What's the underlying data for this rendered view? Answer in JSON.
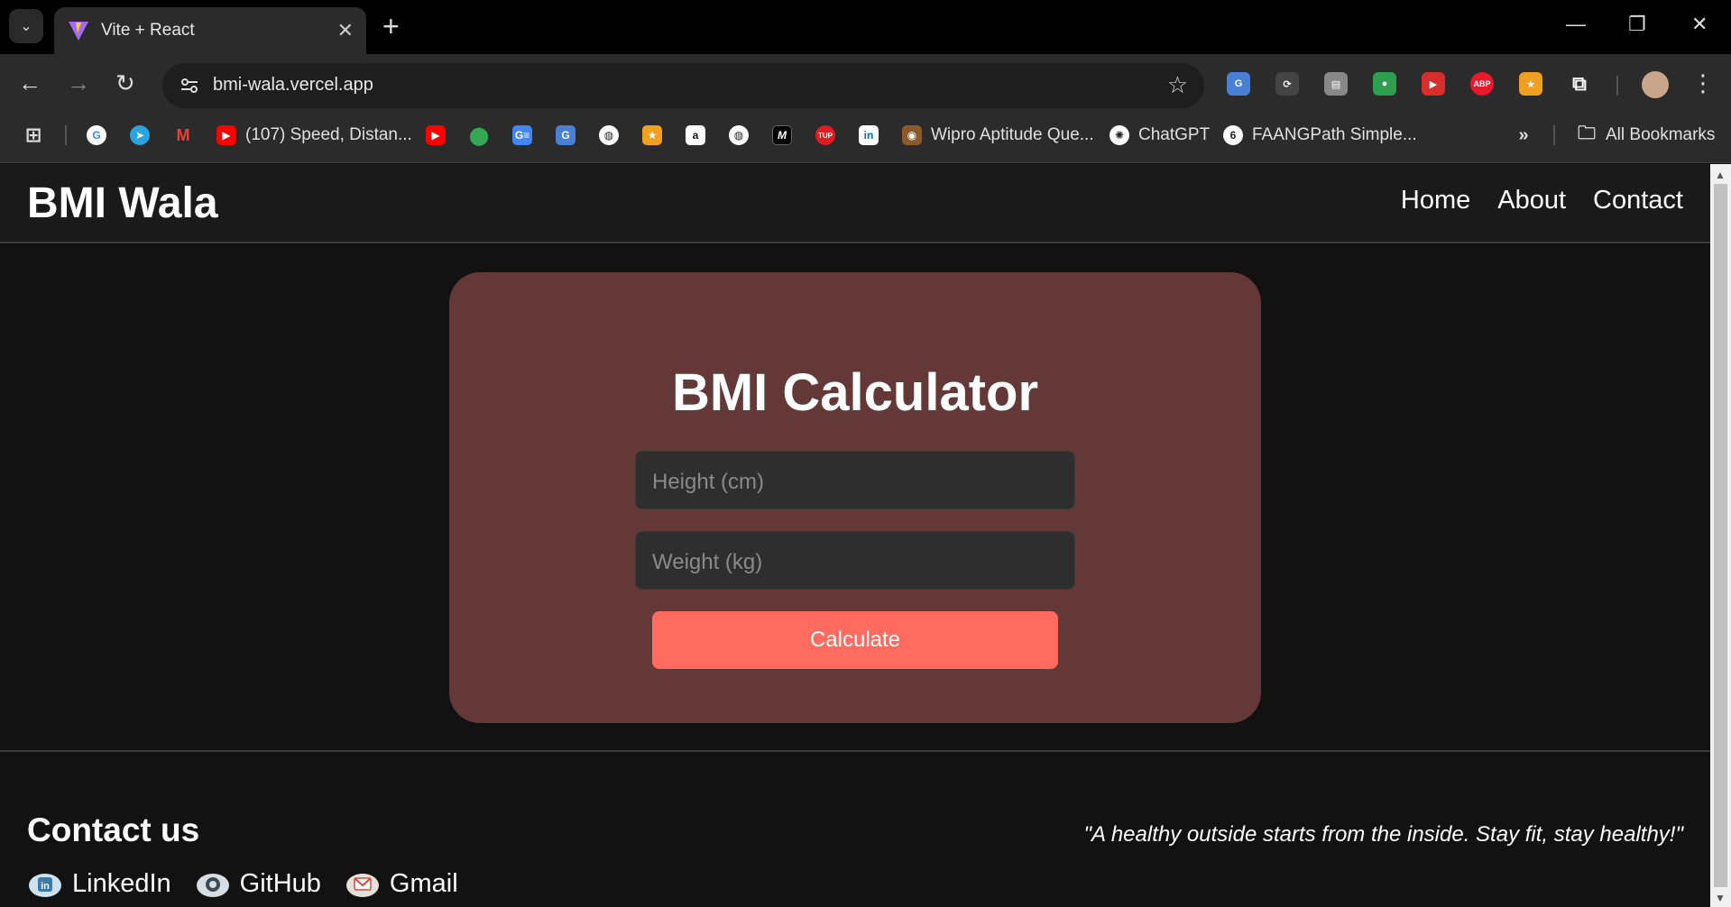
{
  "browser": {
    "tab_title": "Vite + React",
    "url": "bmi-wala.vercel.app",
    "bookmarks": [
      {
        "label": "(107) Speed, Distan...",
        "icon": "youtube-icon",
        "color": "#ff0000"
      },
      {
        "label": "Wipro Aptitude Que...",
        "icon": "wipro-icon",
        "color": "#8b5a2b"
      },
      {
        "label": "ChatGPT",
        "icon": "chatgpt-icon",
        "color": "#ffffff"
      },
      {
        "label": "FAANGPath Simple...",
        "icon": "faangpath-icon",
        "color": "#ffffff"
      }
    ],
    "all_bookmarks": "All Bookmarks",
    "extensions": [
      {
        "name": "translate-icon",
        "text": "G",
        "color": "#4a7fd6"
      },
      {
        "name": "sync-icon",
        "text": "⟳",
        "color": "#444"
      },
      {
        "name": "printer-icon",
        "text": "▤",
        "color": "#888"
      },
      {
        "name": "robot-icon",
        "text": "●",
        "color": "#2e9e4f"
      },
      {
        "name": "play-icon",
        "text": "▶",
        "color": "#d62d2d"
      },
      {
        "name": "adblock-icon",
        "text": "ABP",
        "color": "#e8192c"
      },
      {
        "name": "medal-icon",
        "text": "★",
        "color": "#f0a020"
      },
      {
        "name": "puzzle-icon",
        "text": "⧉",
        "color": "#2b2b2b"
      }
    ]
  },
  "site": {
    "brand": "BMI Wala",
    "nav": [
      "Home",
      "About",
      "Contact"
    ],
    "card": {
      "title": "BMI Calculator",
      "height_placeholder": "Height (cm)",
      "weight_placeholder": "Weight (kg)",
      "button": "Calculate"
    },
    "footer": {
      "contact_title": "Contact us",
      "quote": "\"A healthy outside starts from the inside. Stay fit, stay healthy!\"",
      "links": [
        "LinkedIn",
        "GitHub",
        "Gmail"
      ]
    }
  },
  "colors": {
    "card_bg": "#633837",
    "button_bg": "#ff6b5f",
    "page_bg": "#121212"
  }
}
